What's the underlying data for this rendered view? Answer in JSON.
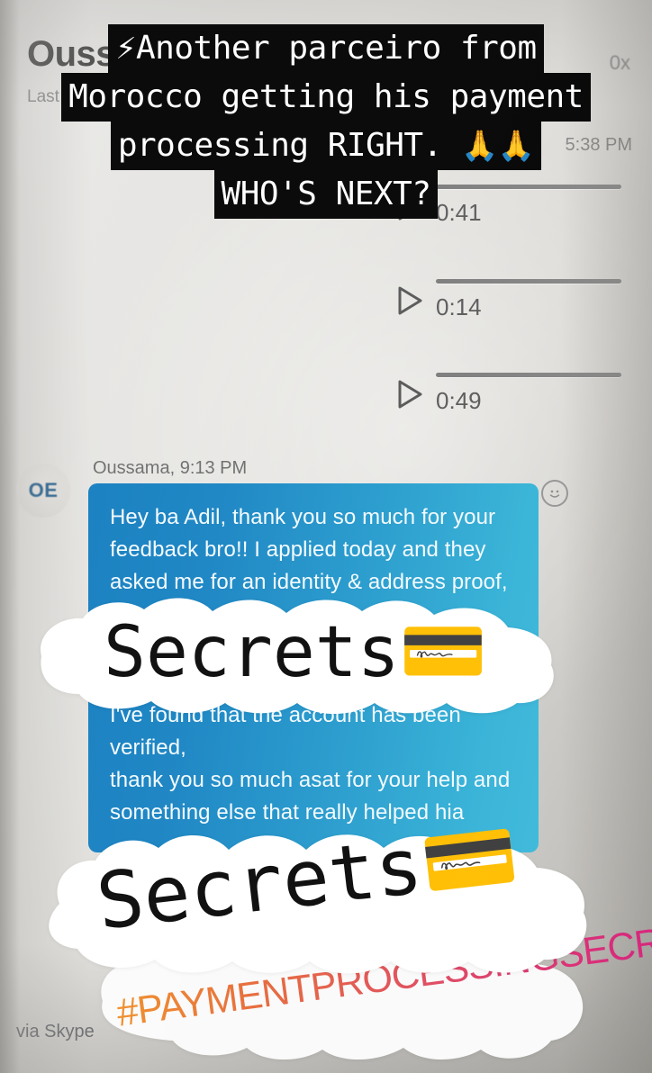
{
  "story": {
    "caption_lines": [
      {
        "emoji": "⚡",
        "text": "Another parceiro from"
      },
      {
        "emoji": "",
        "text": "Morocco getting his payment"
      },
      {
        "emoji": "",
        "text": "processing RIGHT. ",
        "trailing_emoji": "🙏🙏"
      },
      {
        "emoji": "",
        "text": "WHO'S NEXT?"
      }
    ],
    "stickers": [
      {
        "label": "Secrets",
        "emoji": "💳"
      },
      {
        "label": "Secrets",
        "emoji": "💳"
      }
    ],
    "hashtag": "#PAYMENTPROCESSINGSECRETS"
  },
  "chat": {
    "header": {
      "title": "Oussama",
      "subtitle": "Last seen",
      "right_label": "0x"
    },
    "voice_messages": [
      {
        "duration": "0:41",
        "timestamp": "5:38 PM",
        "play_label": "play"
      },
      {
        "duration": "0:14",
        "timestamp": "",
        "play_label": "play"
      },
      {
        "duration": "0:49",
        "timestamp": "",
        "play_label": "play"
      }
    ],
    "message": {
      "author_time": "Oussama, 9:13 PM",
      "avatar_initials": "OE",
      "lines": [
        "Hey ba Adil, thank you so much for your",
        "feedback bro!! I applied today and they",
        "asked me for an identity & address proof,",
        "I've found that the account has been verified,",
        "thank you so much asat for your help and",
        "something else that really helped hia"
      ],
      "reaction_icon": "smiley-icon"
    },
    "footer_label": "via Skype"
  },
  "colors": {
    "bubble_left": "#1b7ec0",
    "bubble_right": "#43bcdc",
    "caption_bg": "#0a0a0a",
    "caption_fg": "#ffffff",
    "hashtag_start": "#f0922f",
    "hashtag_end": "#d41f86",
    "background": "#e4e2df"
  }
}
